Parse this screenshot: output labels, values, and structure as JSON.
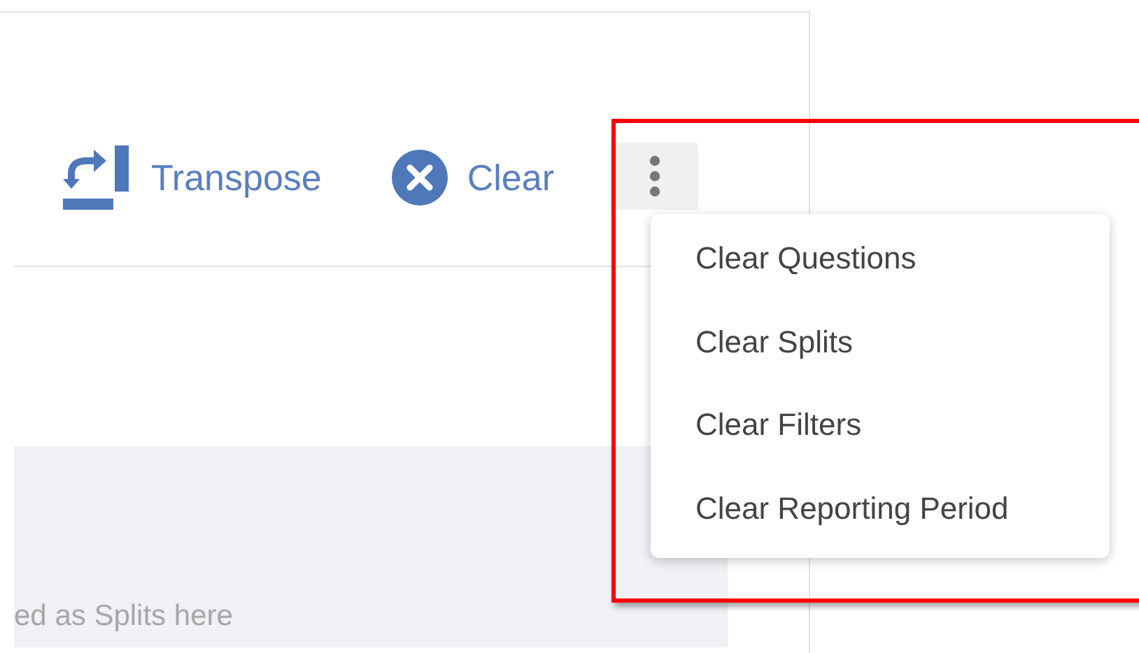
{
  "toolbar": [
    {
      "label": "Transpose",
      "kind": "transpose"
    },
    {
      "label": "Clear",
      "kind": "clear"
    }
  ],
  "more_menu": {
    "expanded": true,
    "items": [
      {
        "label": "Clear Questions"
      },
      {
        "label": "Clear Splits"
      },
      {
        "label": "Clear Filters"
      },
      {
        "label": "Clear Reporting Period"
      }
    ]
  },
  "drop_zone": {
    "hint": "ed as Splits here"
  },
  "highlight_box": true
}
